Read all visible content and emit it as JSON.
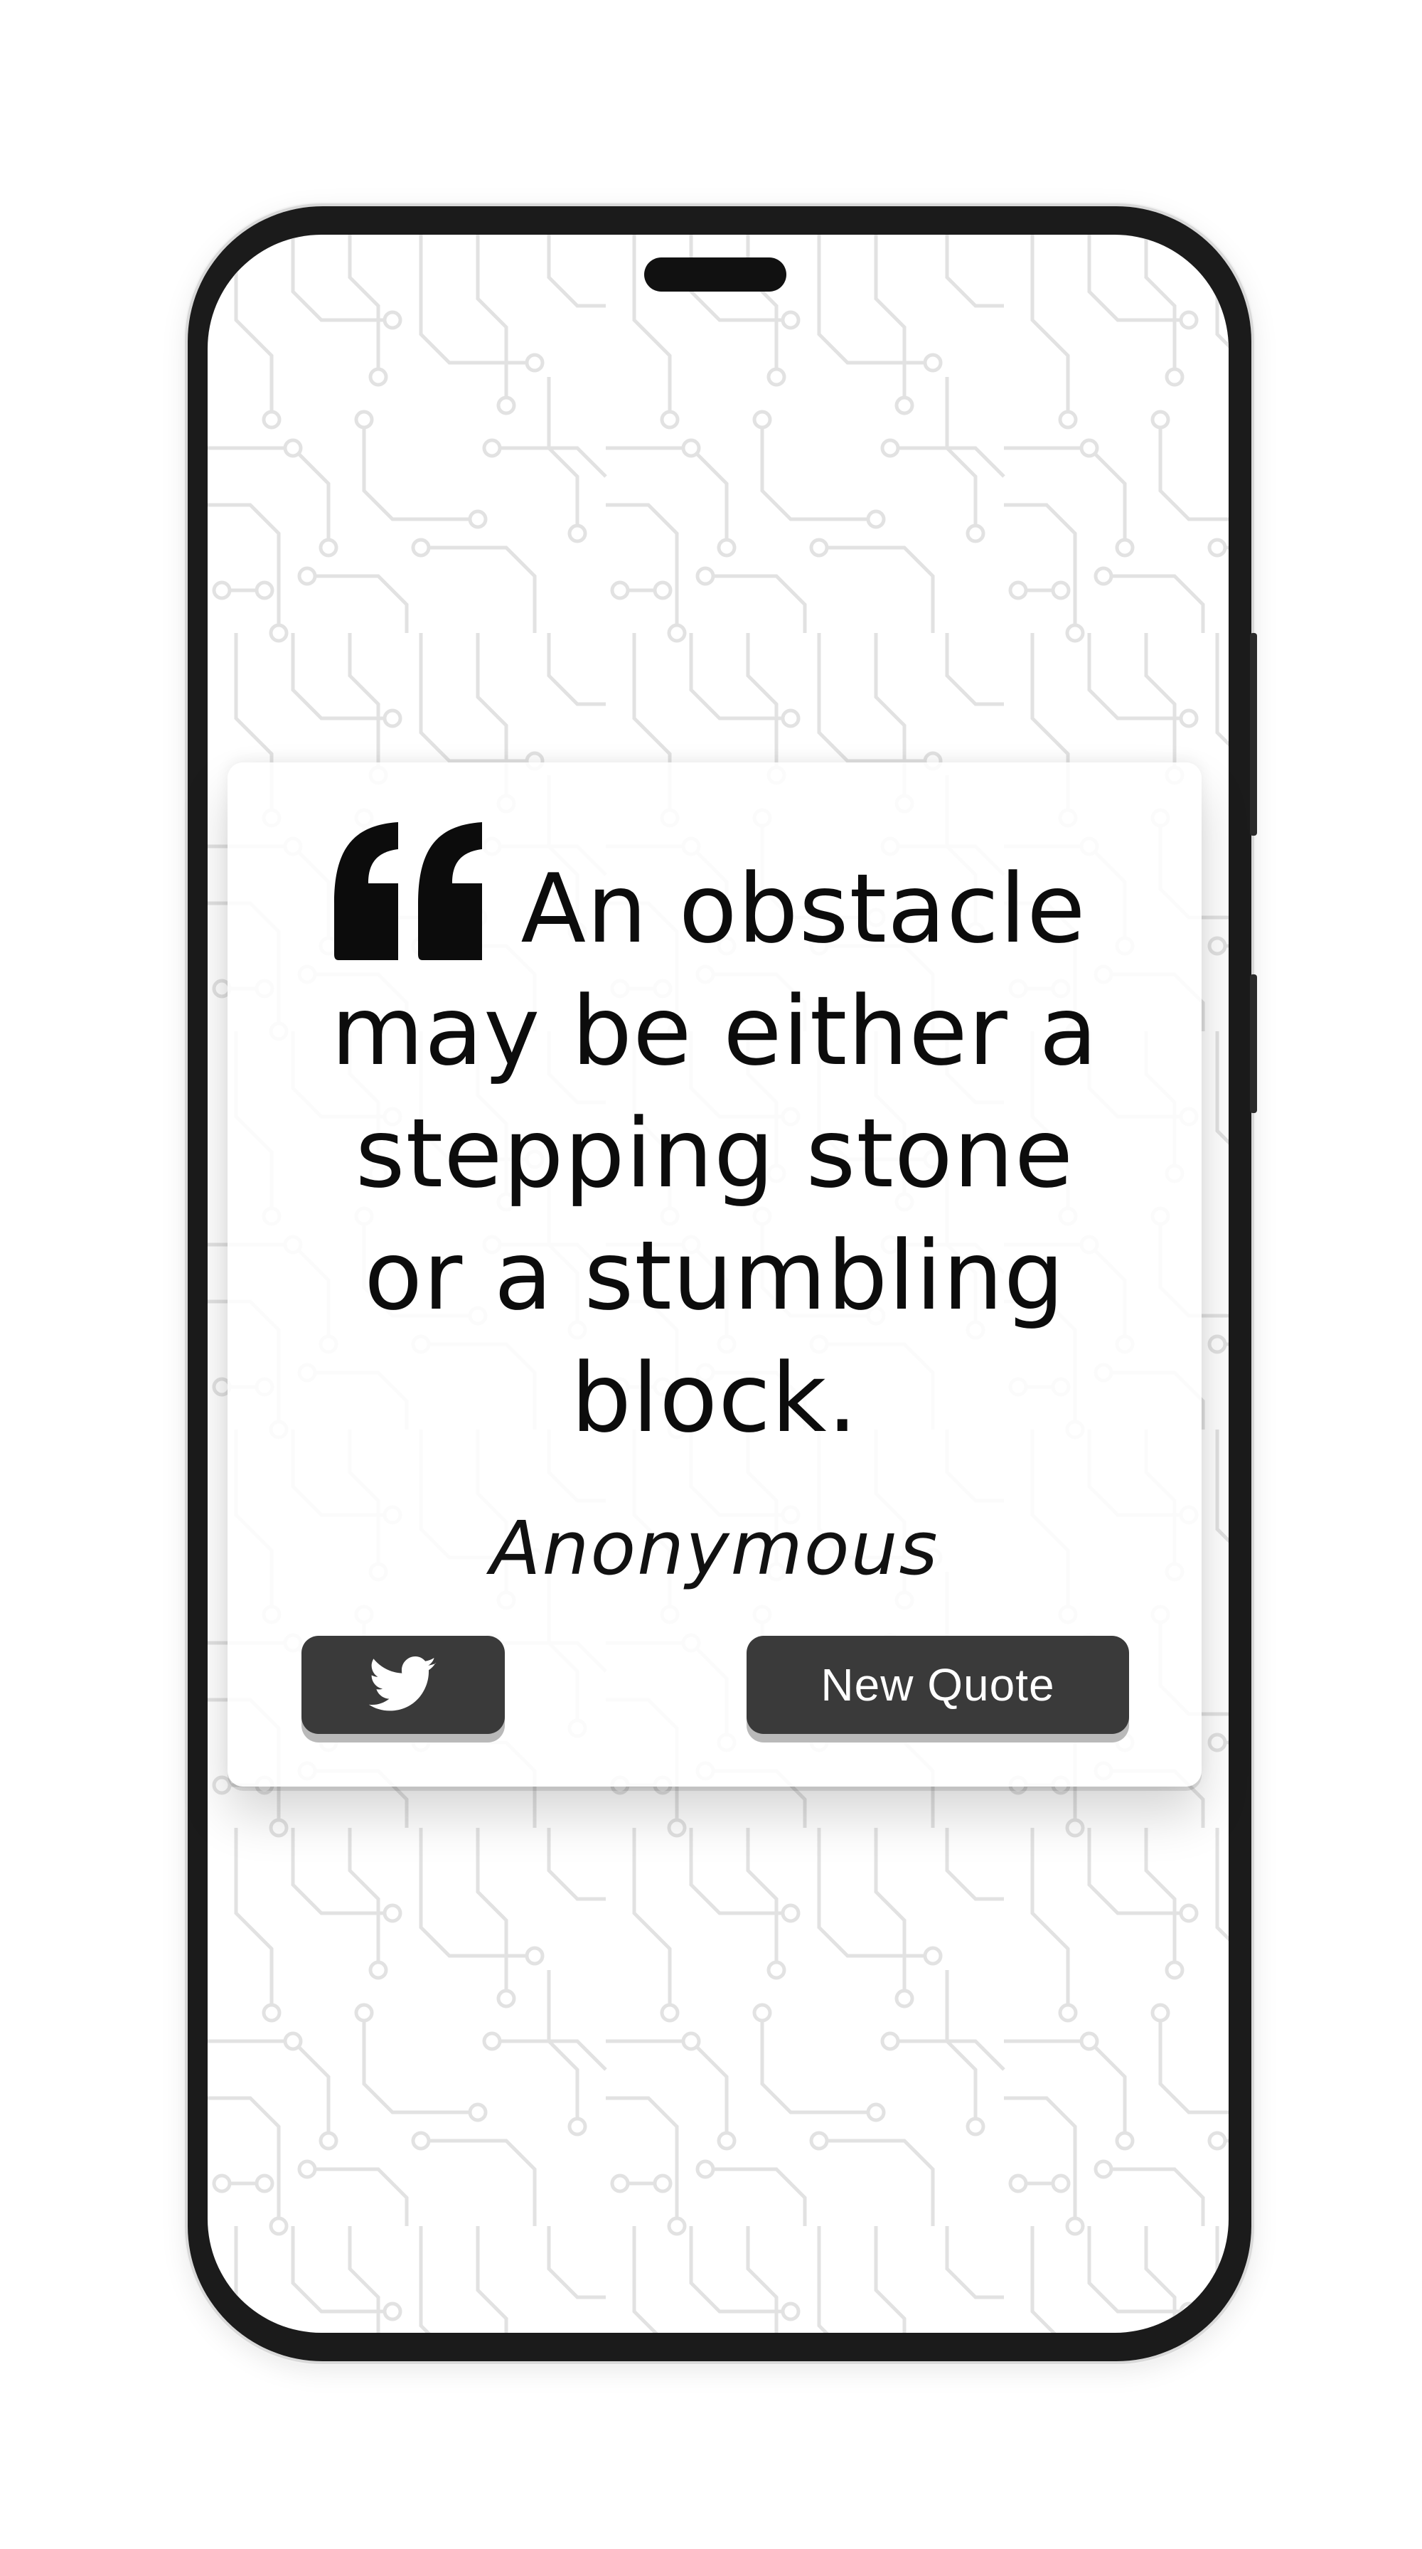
{
  "quote": {
    "text": "An obstacle may be either a stepping stone or a stumbling block.",
    "author": "Anonymous"
  },
  "actions": {
    "tweet_icon": "twitter-bird-icon",
    "new_quote_label": "New Quote"
  },
  "colors": {
    "button_bg": "#3a3a3a",
    "button_text": "#ffffff",
    "quote_text": "#0c0c0c",
    "background_pattern": "#e4e4e4"
  }
}
